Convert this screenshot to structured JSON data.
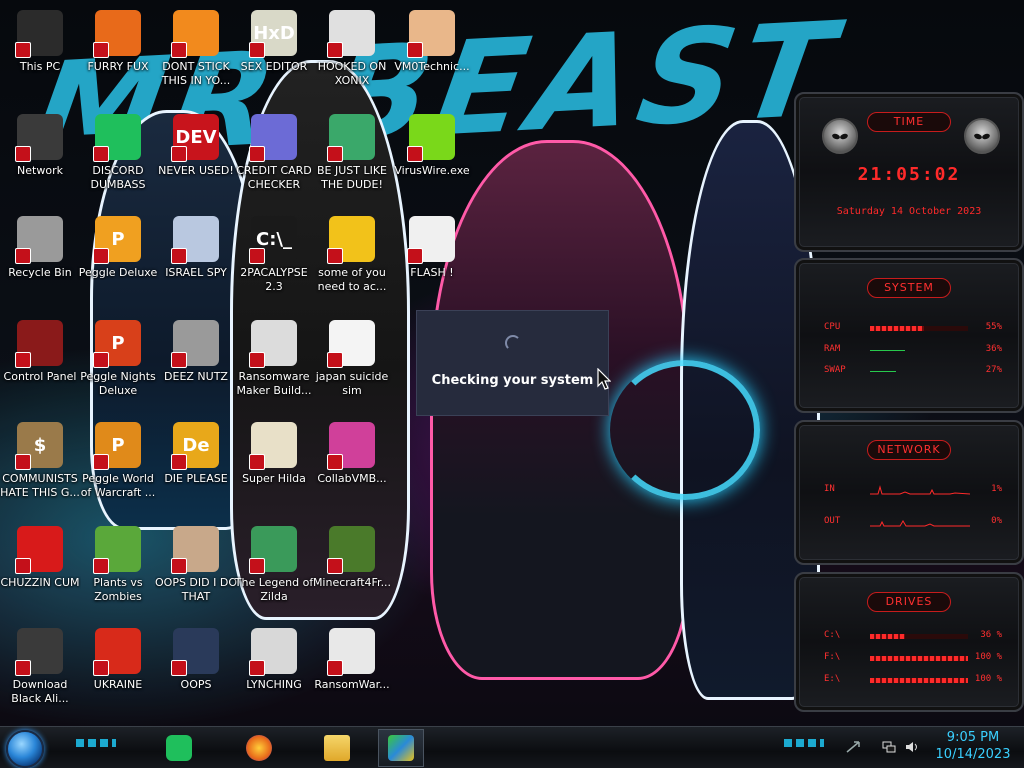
{
  "background": {
    "title": "MR BEAST"
  },
  "desktop_icons": [
    {
      "id": "this-pc",
      "label": "This PC",
      "col": 0,
      "row": 0,
      "glyph": "",
      "color": "#2b2b2b"
    },
    {
      "id": "furry-fux",
      "label": "FURRY FUX",
      "col": 1,
      "row": 0,
      "glyph": "",
      "color": "#e86a1a"
    },
    {
      "id": "dont-stick",
      "label": "DONT STICK THIS IN YO...",
      "col": 2,
      "row": 0,
      "glyph": "",
      "color": "#f28a1d"
    },
    {
      "id": "sex-editor",
      "label": "SEX EDITOR",
      "col": 3,
      "row": 0,
      "glyph": "HxD",
      "color": "#d9d9c8"
    },
    {
      "id": "hooked-on-xonix",
      "label": "HOOKED ON XONIX",
      "col": 4,
      "row": 0,
      "glyph": "",
      "color": "#e0e0e0"
    },
    {
      "id": "vm0technic",
      "label": "VM0Technic...",
      "col": 5,
      "row": 0,
      "glyph": "",
      "color": "#e9b78a"
    },
    {
      "id": "network",
      "label": "Network",
      "col": 0,
      "row": 1,
      "glyph": "",
      "color": "#3a3a3a"
    },
    {
      "id": "discord-dumbass",
      "label": "DISCORD DUMBASS",
      "col": 1,
      "row": 1,
      "glyph": "",
      "color": "#1fbf5c"
    },
    {
      "id": "never-used",
      "label": "NEVER USED!",
      "col": 2,
      "row": 1,
      "glyph": "DEV",
      "color": "#c8141c"
    },
    {
      "id": "credit-card",
      "label": "CREDIT CARD CHECKER",
      "col": 3,
      "row": 1,
      "glyph": "",
      "color": "#6c6bd6"
    },
    {
      "id": "be-just-like",
      "label": "BE JUST LIKE THE DUDE!",
      "col": 4,
      "row": 1,
      "glyph": "",
      "color": "#3aa86a"
    },
    {
      "id": "viruswire",
      "label": "VirusWire.exe",
      "col": 5,
      "row": 1,
      "glyph": "",
      "color": "#7ad81a"
    },
    {
      "id": "recycle-bin",
      "label": "Recycle Bin",
      "col": 0,
      "row": 2,
      "glyph": "",
      "color": "#9a9a9a"
    },
    {
      "id": "peggle-deluxe",
      "label": "Peggle Deluxe",
      "col": 1,
      "row": 2,
      "glyph": "P",
      "color": "#f0a020"
    },
    {
      "id": "israel-spy",
      "label": "ISRAEL SPY",
      "col": 2,
      "row": 2,
      "glyph": "",
      "color": "#b9c8e0"
    },
    {
      "id": "2pacalypse",
      "label": "2PACALYPSE 2.3",
      "col": 3,
      "row": 2,
      "glyph": "C:\\_",
      "color": "#1a1a1a"
    },
    {
      "id": "some-of-you",
      "label": "some of you need to ac...",
      "col": 4,
      "row": 2,
      "glyph": "",
      "color": "#f2c21a"
    },
    {
      "id": "flash",
      "label": "FLASH !",
      "col": 5,
      "row": 2,
      "glyph": "",
      "color": "#f0f0f0"
    },
    {
      "id": "control-panel",
      "label": "Control Panel",
      "col": 0,
      "row": 3,
      "glyph": "",
      "color": "#8a1a1a"
    },
    {
      "id": "peggle-nights",
      "label": "Peggle Nights Deluxe",
      "col": 1,
      "row": 3,
      "glyph": "P",
      "color": "#d8401a"
    },
    {
      "id": "deez-nutz",
      "label": "DEEZ NUTZ",
      "col": 2,
      "row": 3,
      "glyph": "",
      "color": "#9a9a9a"
    },
    {
      "id": "ransomware-maker",
      "label": "Ransomware Maker Build...",
      "col": 3,
      "row": 3,
      "glyph": "",
      "color": "#dcdcdc"
    },
    {
      "id": "japan-suicide",
      "label": "japan suicide sim",
      "col": 4,
      "row": 3,
      "glyph": "",
      "color": "#f4f4f4"
    },
    {
      "id": "communists",
      "label": "COMMUNISTS HATE THIS G...",
      "col": 0,
      "row": 4,
      "glyph": "$",
      "color": "#9a7a4a"
    },
    {
      "id": "peggle-world",
      "label": "Peggle World of Warcraft ...",
      "col": 1,
      "row": 4,
      "glyph": "P",
      "color": "#e08a1a"
    },
    {
      "id": "die-please",
      "label": "DIE PLEASE",
      "col": 2,
      "row": 4,
      "glyph": "De",
      "color": "#e8a81a"
    },
    {
      "id": "super-hilda",
      "label": "Super Hilda",
      "col": 3,
      "row": 4,
      "glyph": "",
      "color": "#e8e0c8"
    },
    {
      "id": "collabvmb",
      "label": "CollabVMB...",
      "col": 4,
      "row": 4,
      "glyph": "",
      "color": "#d0409a"
    },
    {
      "id": "chuzzin-cum",
      "label": "CHUZZIN CUM",
      "col": 0,
      "row": 5,
      "glyph": "",
      "color": "#d81a1a"
    },
    {
      "id": "plants-vs-zombies",
      "label": "Plants vs Zombies",
      "col": 1,
      "row": 5,
      "glyph": "",
      "color": "#5aa83a"
    },
    {
      "id": "oops-did-i",
      "label": "OOPS DID I DO THAT",
      "col": 2,
      "row": 5,
      "glyph": "",
      "color": "#c8a88a"
    },
    {
      "id": "legend-of-zilda",
      "label": "The Legend of Zilda",
      "col": 3,
      "row": 5,
      "glyph": "",
      "color": "#3a9a5a"
    },
    {
      "id": "minecraft4fr",
      "label": "Minecraft4Fr...",
      "col": 4,
      "row": 5,
      "glyph": "",
      "color": "#4a7a2a"
    },
    {
      "id": "download-black-ali",
      "label": "Download Black Ali...",
      "col": 0,
      "row": 6,
      "glyph": "",
      "color": "#3a3a3a"
    },
    {
      "id": "ukraine",
      "label": "UKRAINE",
      "col": 1,
      "row": 6,
      "glyph": "",
      "color": "#d82a1a"
    },
    {
      "id": "oops",
      "label": "OOPS",
      "col": 2,
      "row": 6,
      "glyph": "",
      "color": "#2a3a5a"
    },
    {
      "id": "lynching",
      "label": "LYNCHING",
      "col": 3,
      "row": 6,
      "glyph": "",
      "color": "#d8d8d8"
    },
    {
      "id": "ransomwar",
      "label": "RansomWar...",
      "col": 4,
      "row": 6,
      "glyph": "",
      "color": "#e8e8e8"
    }
  ],
  "dialog": {
    "message": "Checking your system"
  },
  "gadgets": {
    "time": {
      "title": "TIME",
      "clock": "21:05:02",
      "date": "Saturday 14 October 2023"
    },
    "system": {
      "title": "SYSTEM",
      "rows": [
        {
          "name": "CPU",
          "value": "55%",
          "level": 0.55
        },
        {
          "name": "RAM",
          "value": "36%",
          "level": 0.36
        },
        {
          "name": "SWAP",
          "value": "27%",
          "level": 0.27
        }
      ]
    },
    "network": {
      "title": "NETWORK",
      "rows": [
        {
          "name": "IN",
          "value": "1%"
        },
        {
          "name": "OUT",
          "value": "0%"
        }
      ]
    },
    "drives": {
      "title": "DRIVES",
      "rows": [
        {
          "name": "C:\\",
          "value": "36 %",
          "level": 0.36
        },
        {
          "name": "F:\\",
          "value": "100 %",
          "level": 1.0
        },
        {
          "name": "E:\\",
          "value": "100 %",
          "level": 1.0
        }
      ]
    }
  },
  "taskbar": {
    "pinned": [
      {
        "id": "discord",
        "color": "#1fbf5c",
        "icon": "discord-icon"
      },
      {
        "id": "firefox",
        "color": "#e86a1a",
        "icon": "firefox-icon"
      },
      {
        "id": "explorer",
        "color": "#e8c23a",
        "icon": "folder-icon"
      },
      {
        "id": "bluestacks",
        "color": "#5ac83a",
        "icon": "bluestacks-icon",
        "active": true
      }
    ],
    "time": "9:05 PM",
    "date": "10/14/2023"
  }
}
